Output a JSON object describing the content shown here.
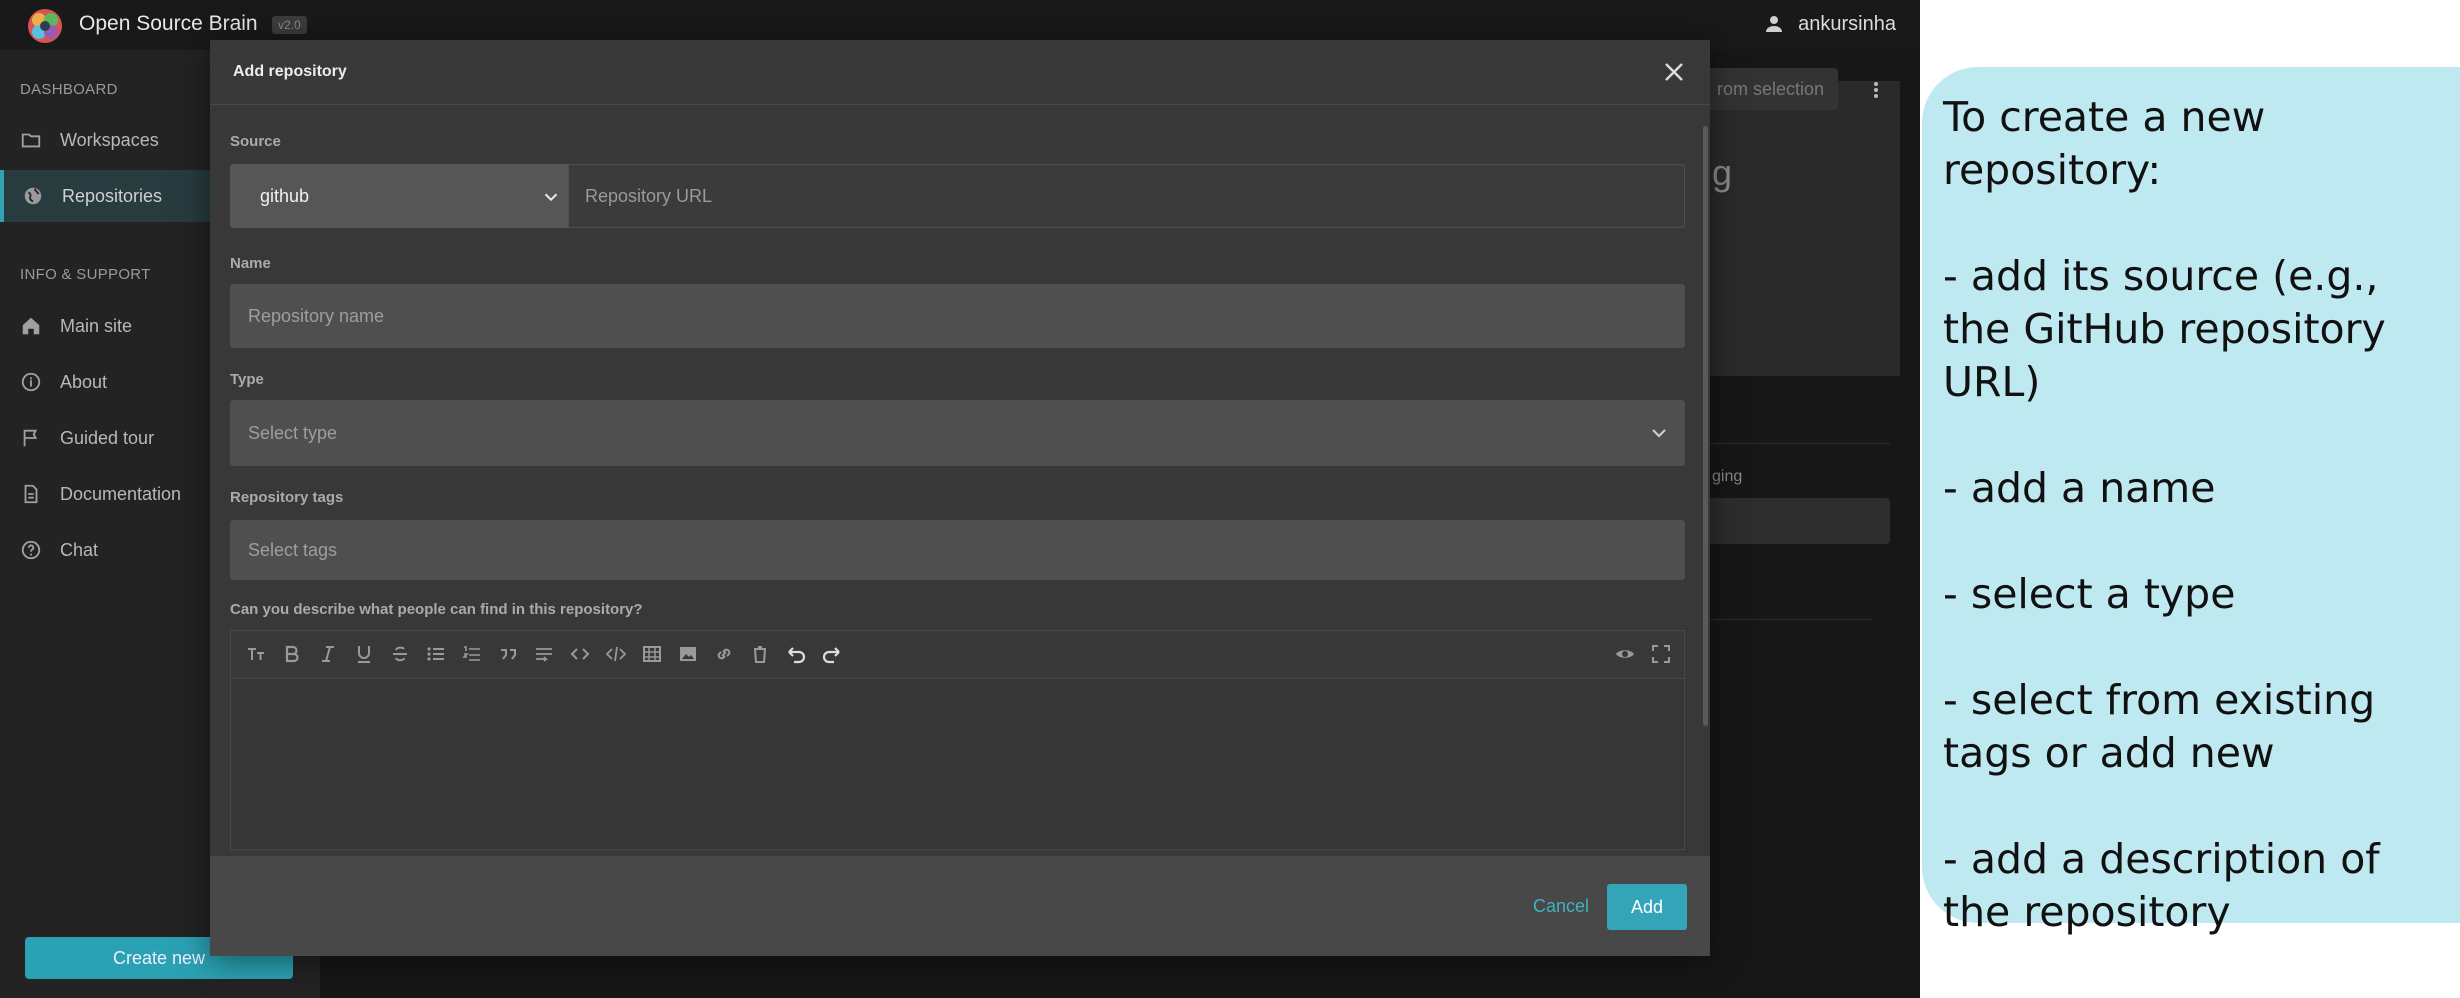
{
  "app": {
    "name": "Open Source Brain",
    "version": "v2.0",
    "user": "ankursinha"
  },
  "sidebar": {
    "sections": [
      {
        "label": "DASHBOARD"
      },
      {
        "label": "INFO & SUPPORT"
      }
    ],
    "items": [
      {
        "label": "Workspaces",
        "icon": "folder-icon"
      },
      {
        "label": "Repositories",
        "icon": "globe-icon",
        "active": true
      },
      {
        "label": "Main site",
        "icon": "home-icon"
      },
      {
        "label": "About",
        "icon": "info-icon"
      },
      {
        "label": "Guided tour",
        "icon": "flag-icon"
      },
      {
        "label": "Documentation",
        "icon": "document-icon"
      },
      {
        "label": "Chat",
        "icon": "help-icon"
      }
    ],
    "create_label": "Create new"
  },
  "background": {
    "button_label": "rom selection",
    "title_fragment": "g",
    "label_fragment": "ging"
  },
  "dialog": {
    "title": "Add repository",
    "source": {
      "label": "Source",
      "selected": "github",
      "url_placeholder": "Repository URL"
    },
    "name": {
      "label": "Name",
      "placeholder": "Repository name"
    },
    "type": {
      "label": "Type",
      "placeholder": "Select type"
    },
    "tags": {
      "label": "Repository tags",
      "placeholder": "Select tags"
    },
    "description": {
      "label": "Can you describe what people can find in this repository?"
    },
    "editor_tools": [
      "heading-icon",
      "bold-icon",
      "italic-icon",
      "underline-icon",
      "strikethrough-icon",
      "bulleted-list-icon",
      "numbered-list-icon",
      "quote-icon",
      "horizontal-rule-icon",
      "inline-code-icon",
      "code-block-icon",
      "table-icon",
      "image-icon",
      "link-icon",
      "delete-icon",
      "undo-icon",
      "redo-icon",
      "preview-icon",
      "fullscreen-icon"
    ],
    "cancel_label": "Cancel",
    "add_label": "Add"
  },
  "instructions": {
    "text": "To create a new repository:\n\n- add its source (e.g., the GitHub repository URL)\n\n- add a name\n\n- select a type\n\n- select from existing tags or add new\n\n- add a description of the repository"
  },
  "colors": {
    "accent": "#34a5b8",
    "note_bg": "#bfe9f0",
    "dialog_bg": "#383838"
  }
}
